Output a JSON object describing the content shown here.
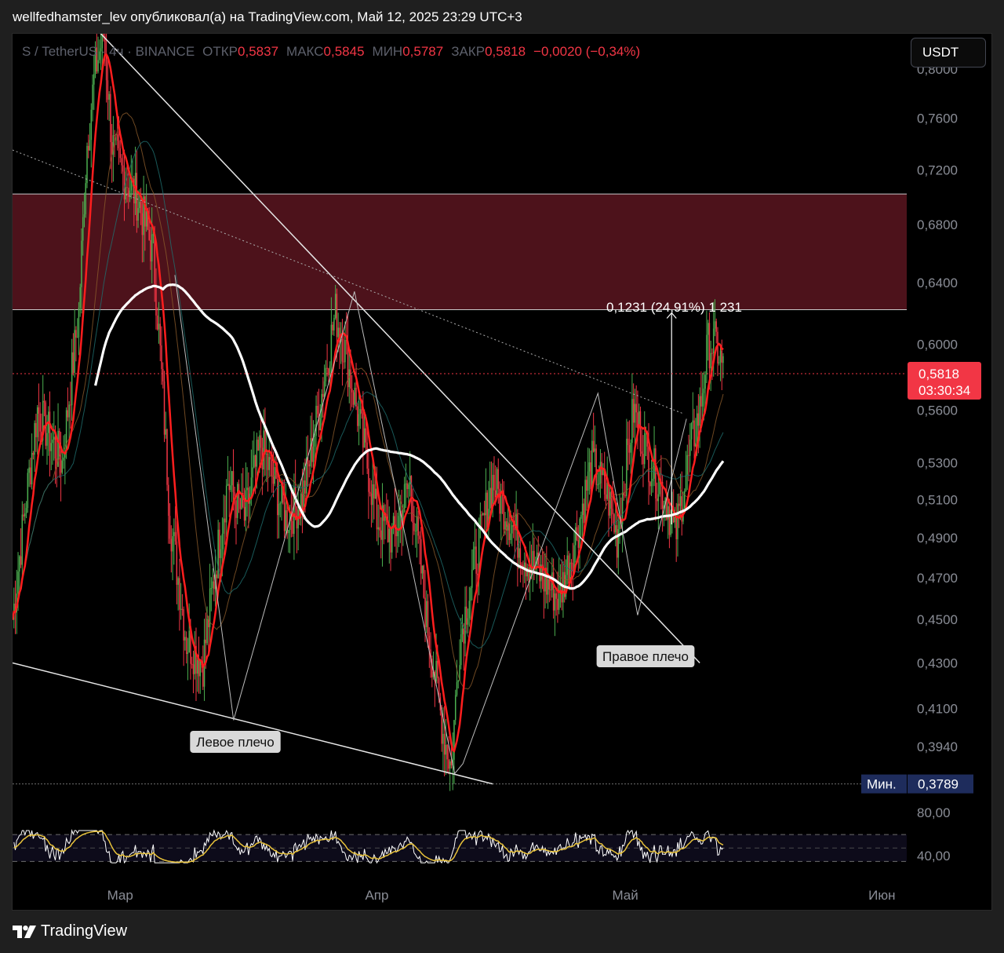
{
  "caption": "wellfedhamster_lev опубликовал(а) на TradingView.com, Май 12, 2025 23:29 UTC+3",
  "legend": {
    "symbol": "S / TetherUS · 4ч · BINANCE",
    "open_label": "ОТКР",
    "open_value": "0,5837",
    "high_label": "МАКС",
    "high_value": "0,5845",
    "low_label": "МИН",
    "low_value": "0,5787",
    "close_label": "ЗАКР",
    "close_value": "0,5818",
    "change": "−0,0020 (−0,34%)"
  },
  "currency_button": "USDT",
  "brand": "TradingView",
  "colors": {
    "up": "#4caf50",
    "down": "#f23645",
    "zone": "#5a1520",
    "ma_fast": "#ff1e1e",
    "ma_slow": "#ffffff",
    "rsi": "#ffffff",
    "rsi_ma": "#e8c23a",
    "price_tag": "#f23645",
    "min_tag": "#1e2c5c"
  },
  "chart_data": {
    "type": "candlestick",
    "timeframe": "4ч",
    "y_ticks": [
      "0,8000",
      "0,7600",
      "0,7200",
      "0,6800",
      "0,6400",
      "0,6000",
      "0,5600",
      "0,5300",
      "0,5100",
      "0,4900",
      "0,4700",
      "0,4500",
      "0,4300",
      "0,4100",
      "0,3940"
    ],
    "y_tick_values": [
      0.8,
      0.76,
      0.72,
      0.68,
      0.64,
      0.6,
      0.56,
      0.53,
      0.51,
      0.49,
      0.47,
      0.45,
      0.43,
      0.41,
      0.394
    ],
    "x_ticks": [
      "Мар",
      "Апр",
      "Май",
      "Июн"
    ],
    "x_tick_day_index": [
      13,
      44,
      74,
      105
    ],
    "y_scale": "log",
    "ylim": [
      0.372,
      0.83
    ],
    "price_path": [
      [
        0,
        0.45
      ],
      [
        3,
        0.56
      ],
      [
        6,
        0.53
      ],
      [
        8,
        0.62
      ],
      [
        9,
        0.74
      ],
      [
        10,
        0.8
      ],
      [
        11,
        0.83
      ],
      [
        12,
        0.74
      ],
      [
        13,
        0.72
      ],
      [
        15,
        0.7
      ],
      [
        17,
        0.66
      ],
      [
        19,
        0.5
      ],
      [
        21,
        0.44
      ],
      [
        23,
        0.43
      ],
      [
        24,
        0.46
      ],
      [
        26,
        0.52
      ],
      [
        28,
        0.5
      ],
      [
        30,
        0.54
      ],
      [
        33,
        0.5
      ],
      [
        35,
        0.51
      ],
      [
        37,
        0.56
      ],
      [
        39,
        0.62
      ],
      [
        40,
        0.6
      ],
      [
        42,
        0.55
      ],
      [
        44,
        0.5
      ],
      [
        46,
        0.49
      ],
      [
        48,
        0.52
      ],
      [
        50,
        0.45
      ],
      [
        52,
        0.4
      ],
      [
        53,
        0.385
      ],
      [
        54,
        0.44
      ],
      [
        56,
        0.48
      ],
      [
        58,
        0.52
      ],
      [
        60,
        0.5
      ],
      [
        62,
        0.48
      ],
      [
        64,
        0.47
      ],
      [
        66,
        0.46
      ],
      [
        68,
        0.49
      ],
      [
        70,
        0.53
      ],
      [
        72,
        0.51
      ],
      [
        73,
        0.49
      ],
      [
        75,
        0.56
      ],
      [
        77,
        0.53
      ],
      [
        79,
        0.51
      ],
      [
        80,
        0.49
      ],
      [
        82,
        0.54
      ],
      [
        83,
        0.56
      ],
      [
        84,
        0.6
      ],
      [
        85,
        0.6
      ],
      [
        86,
        0.58
      ]
    ],
    "current_price": "0,5818",
    "countdown": "03:30:34",
    "min_label": "Мин.",
    "min_value": "0,3789",
    "supply_zone": [
      0.622,
      0.702
    ],
    "measure_label": "0,1231 (24,91%) 1 231",
    "annotations": [
      "Левое плечо",
      "Правое плечо"
    ],
    "rsi": {
      "levels": [
        "80,00",
        "40,00"
      ],
      "band": [
        70,
        30
      ]
    }
  }
}
